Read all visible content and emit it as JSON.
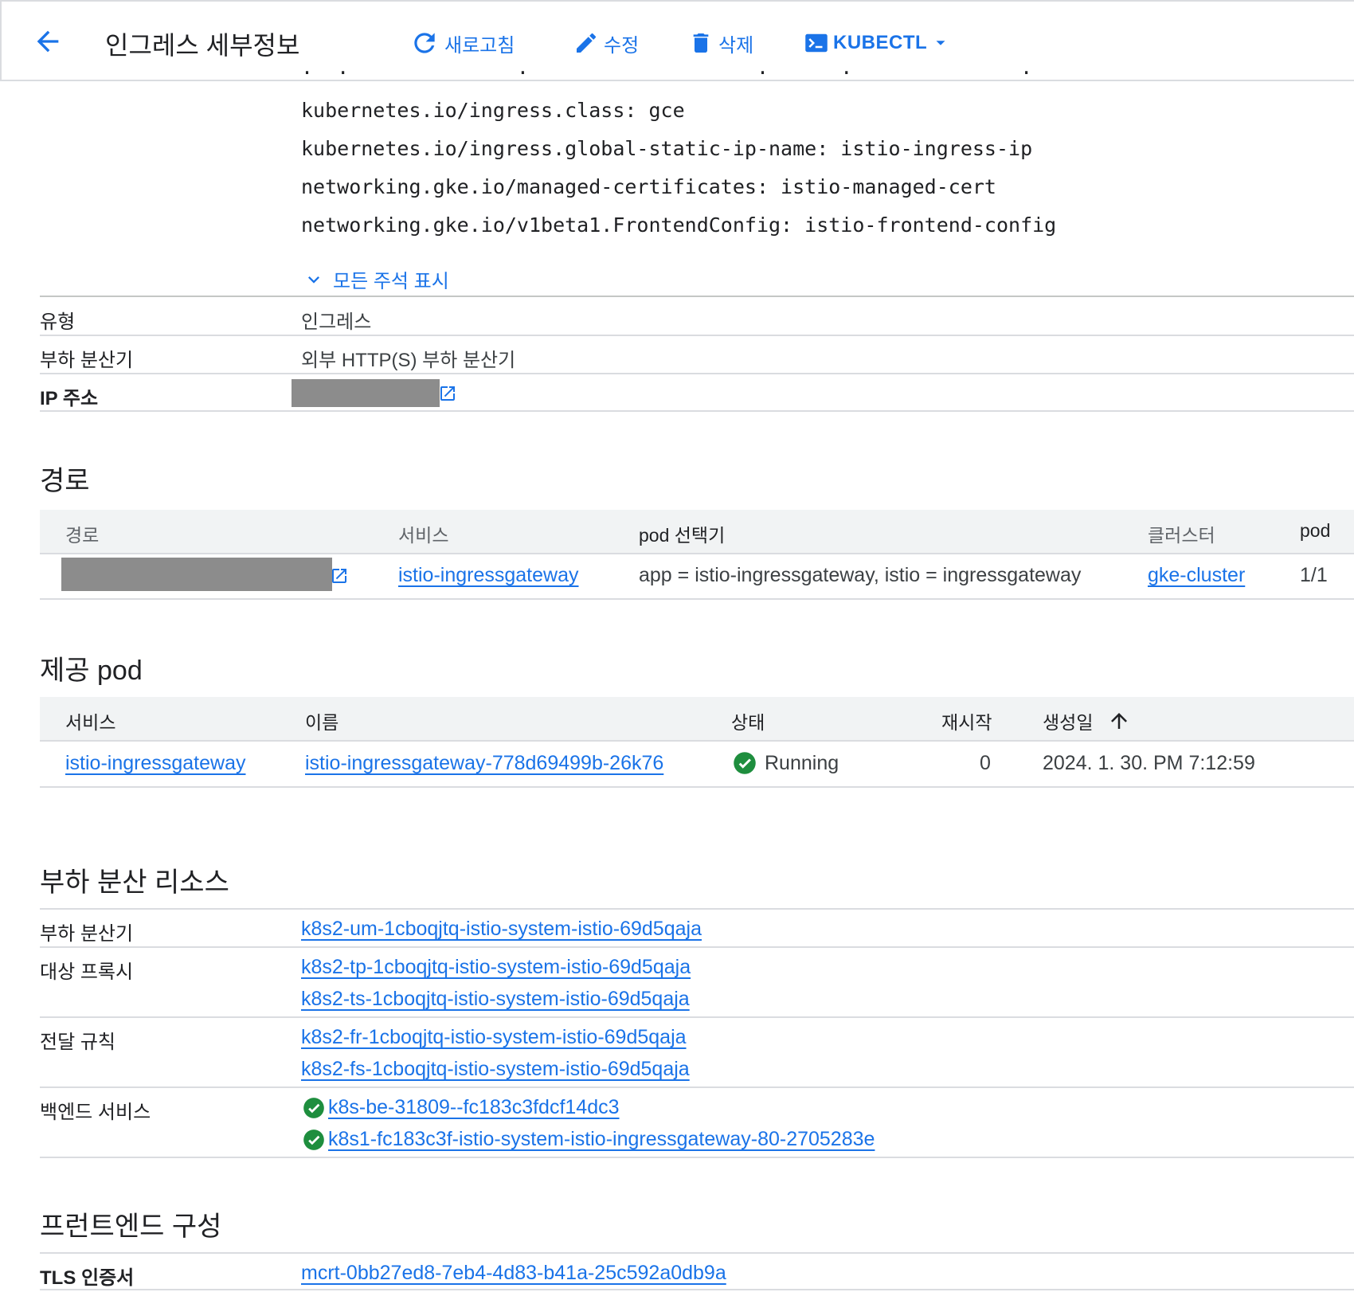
{
  "toolbar": {
    "title": "인그레스 세부정보",
    "refresh_label": "새로고침",
    "edit_label": "수정",
    "delete_label": "삭제",
    "kubectl_label": "KUBECTL"
  },
  "annotations": {
    "lines": [
      "kubernetes.io/ingress.class: gce",
      "kubernetes.io/ingress.global-static-ip-name: istio-ingress-ip",
      "networking.gke.io/managed-certificates: istio-managed-cert",
      "networking.gke.io/v1beta1.FrontendConfig: istio-frontend-config"
    ],
    "show_all_label": "모든 주석 표시"
  },
  "details": {
    "type_label": "유형",
    "type_value": "인그레스",
    "lb_label": "부하 분산기",
    "lb_value": "외부 HTTP(S) 부하 분산기",
    "ip_label": "IP 주소"
  },
  "routes": {
    "title": "경로",
    "columns": [
      "경로",
      "서비스",
      "pod 선택기",
      "클러스터",
      "pod"
    ],
    "row": {
      "service": "istio-ingressgateway",
      "selector": "app = istio-ingressgateway, istio = ingressgateway",
      "cluster": "gke-cluster",
      "pods": "1/1"
    }
  },
  "serving_pods": {
    "title": "제공 pod",
    "columns": [
      "서비스",
      "이름",
      "상태",
      "재시작",
      "생성일"
    ],
    "row": {
      "service": "istio-ingressgateway",
      "name": "istio-ingressgateway-778d69499b-26k76",
      "status": "Running",
      "restarts": "0",
      "created": "2024. 1. 30. PM 7:12:59"
    }
  },
  "lb_resources": {
    "title": "부하 분산 리소스",
    "load_balancer_label": "부하 분산기",
    "load_balancer": "k8s2-um-1cboqjtq-istio-system-istio-69d5qaja",
    "target_proxy_label": "대상 프록시",
    "target_proxies": [
      "k8s2-tp-1cboqjtq-istio-system-istio-69d5qaja",
      "k8s2-ts-1cboqjtq-istio-system-istio-69d5qaja"
    ],
    "forwarding_label": "전달 규칙",
    "forwarding_rules": [
      "k8s2-fr-1cboqjtq-istio-system-istio-69d5qaja",
      "k8s2-fs-1cboqjtq-istio-system-istio-69d5qaja"
    ],
    "backend_label": "백엔드 서비스",
    "backend_services": [
      "k8s-be-31809--fc183c3fdcf14dc3",
      "k8s1-fc183c3f-istio-system-istio-ingressgateway-80-2705283e"
    ]
  },
  "frontend": {
    "title": "프런트엔드 구성",
    "tls_label": "TLS 인증서",
    "tls_value": "mcrt-0bb27ed8-7eb4-4d83-b41a-25c592a0db9a"
  },
  "colors": {
    "accent": "#1a73e8",
    "success": "#1e8e3e",
    "header_bg": "#f1f3f4",
    "redaction": "#8c8c8c"
  }
}
